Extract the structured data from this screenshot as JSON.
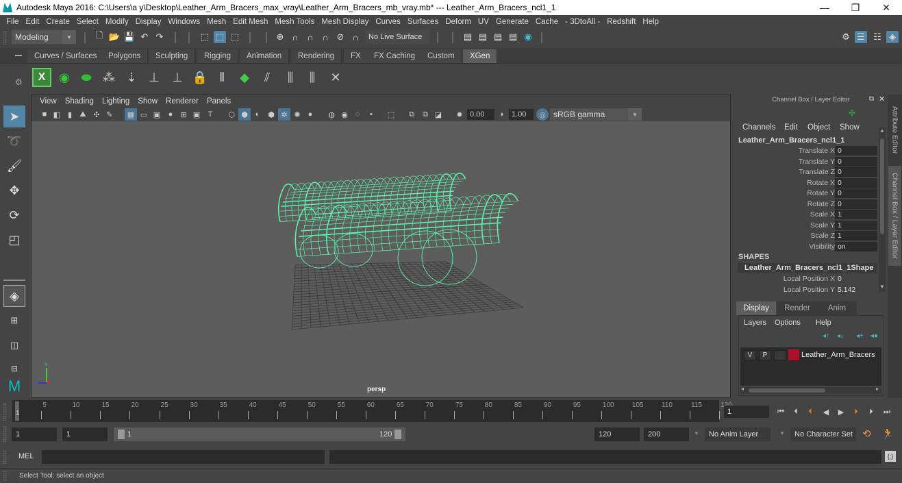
{
  "window": {
    "title": "Autodesk Maya 2016: C:\\Users\\a y\\Desktop\\Leather_Arm_Bracers_max_vray\\Leather_Arm_Bracers_mb_vray.mb*   ---   Leather_Arm_Bracers_ncl1_1",
    "minimize": "—",
    "maximize": "❐",
    "close": "✕"
  },
  "menubar": [
    "File",
    "Edit",
    "Create",
    "Select",
    "Modify",
    "Display",
    "Windows",
    "Mesh",
    "Edit Mesh",
    "Mesh Tools",
    "Mesh Display",
    "Curves",
    "Surfaces",
    "Deform",
    "UV",
    "Generate",
    "Cache",
    "- 3DtoAll -",
    "Redshift",
    "Help"
  ],
  "statusline": {
    "mode": "Modeling",
    "live_surface": "No Live Surface"
  },
  "shelf": {
    "tabs": [
      "Curves / Surfaces",
      "Polygons",
      "Sculpting",
      "Rigging",
      "Animation",
      "Rendering",
      "FX",
      "FX Caching",
      "Custom",
      "XGen"
    ],
    "active_tab": "XGen"
  },
  "viewport": {
    "menu": [
      "View",
      "Shading",
      "Lighting",
      "Show",
      "Renderer",
      "Panels"
    ],
    "exposure": "0.00",
    "gamma": "1.00",
    "color_space": "sRGB gamma",
    "camera_label": "persp",
    "axis": {
      "y": "Y",
      "z": "Z",
      "x": "X"
    },
    "wire_color": "#5ef0a8"
  },
  "channel_box": {
    "title": "Channel Box / Layer Editor",
    "menu": [
      "Channels",
      "Edit",
      "Object",
      "Show"
    ],
    "object_name": "Leather_Arm_Bracers_ncl1_1",
    "attributes": [
      {
        "label": "Translate X",
        "value": "0"
      },
      {
        "label": "Translate Y",
        "value": "0"
      },
      {
        "label": "Translate Z",
        "value": "0"
      },
      {
        "label": "Rotate X",
        "value": "0"
      },
      {
        "label": "Rotate Y",
        "value": "0"
      },
      {
        "label": "Rotate Z",
        "value": "0"
      },
      {
        "label": "Scale X",
        "value": "1"
      },
      {
        "label": "Scale Y",
        "value": "1"
      },
      {
        "label": "Scale Z",
        "value": "1"
      },
      {
        "label": "Visibility",
        "value": "on"
      }
    ],
    "shapes_header": "SHAPES",
    "shape_name": "Leather_Arm_Bracers_ncl1_1Shape",
    "shape_attributes": [
      {
        "label": "Local Position X",
        "value": "0"
      },
      {
        "label": "Local Position Y",
        "value": "5.142"
      }
    ]
  },
  "layer_editor": {
    "tabs": [
      "Display",
      "Render",
      "Anim"
    ],
    "active_tab": "Display",
    "menu": [
      "Layers",
      "Options",
      "Help"
    ],
    "layers": [
      {
        "v": "V",
        "p": "P",
        "name": "Leather_Arm_Bracers",
        "color": "#b0102a"
      }
    ]
  },
  "side_tabs": [
    "Attribute Editor",
    "Channel Box / Layer Editor"
  ],
  "time_slider": {
    "ticks": [
      5,
      10,
      15,
      20,
      25,
      30,
      35,
      40,
      45,
      50,
      55,
      60,
      65,
      70,
      75,
      80,
      85,
      90,
      95,
      100,
      105,
      110,
      115,
      120
    ],
    "start": 1,
    "end": 120,
    "current_frame_marker": "1",
    "current_frame": "1"
  },
  "range_slider": {
    "start_time": "1",
    "playback_start": "1",
    "range_start_label": "1",
    "range_end_label": "120",
    "playback_end": "120",
    "end_time": "200",
    "anim_layer": "No Anim Layer",
    "character_set": "No Character Set"
  },
  "command_line": {
    "label": "MEL"
  },
  "help_line": "Select Tool: select an object"
}
